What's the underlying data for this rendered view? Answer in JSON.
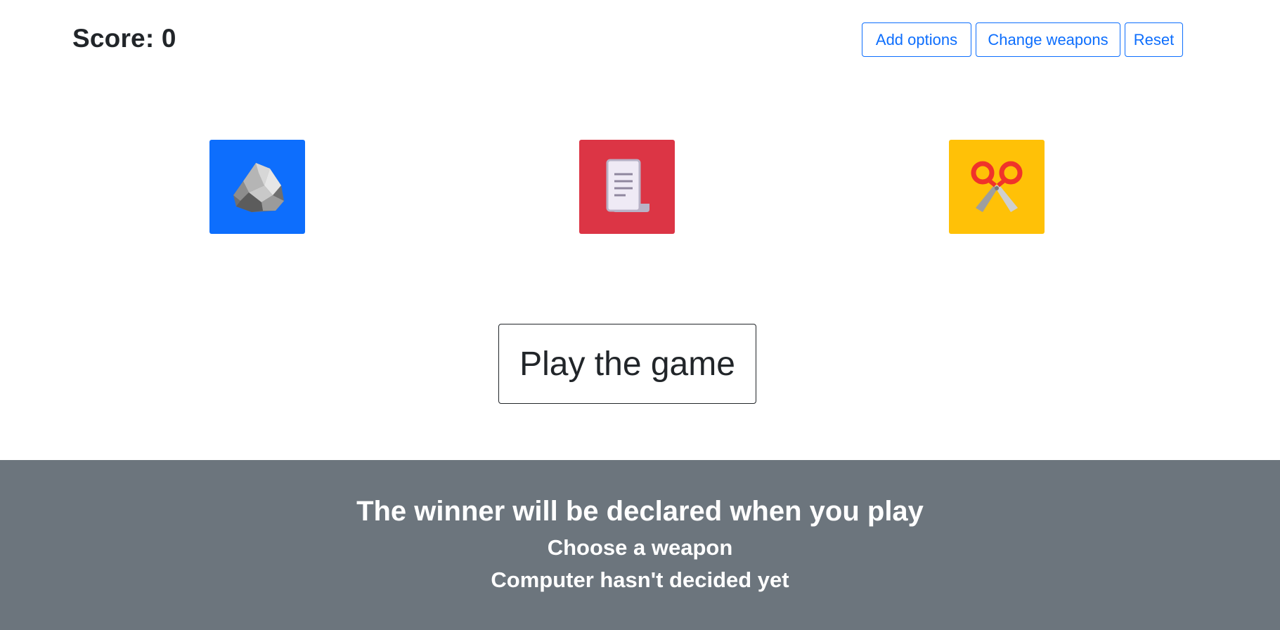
{
  "header": {
    "score_label": "Score: 0"
  },
  "toolbar": {
    "add_options_label": "Add options",
    "change_weapons_label": "Change weapons",
    "reset_label": "Reset"
  },
  "weapons": [
    {
      "name": "rock",
      "icon": "rock-icon",
      "background": "#0d6efd"
    },
    {
      "name": "paper",
      "icon": "paper-scroll-icon",
      "background": "#dc3545"
    },
    {
      "name": "scissors",
      "icon": "scissors-icon",
      "background": "#ffc107"
    }
  ],
  "play": {
    "label": "Play the game"
  },
  "result": {
    "title": "The winner will be declared when you play",
    "player_choice": "Choose a weapon",
    "computer_choice": "Computer hasn't decided yet"
  },
  "colors": {
    "primary": "#0d6efd",
    "danger": "#dc3545",
    "warning": "#ffc107",
    "footer_bg": "#6c757d",
    "text_dark": "#212529"
  }
}
